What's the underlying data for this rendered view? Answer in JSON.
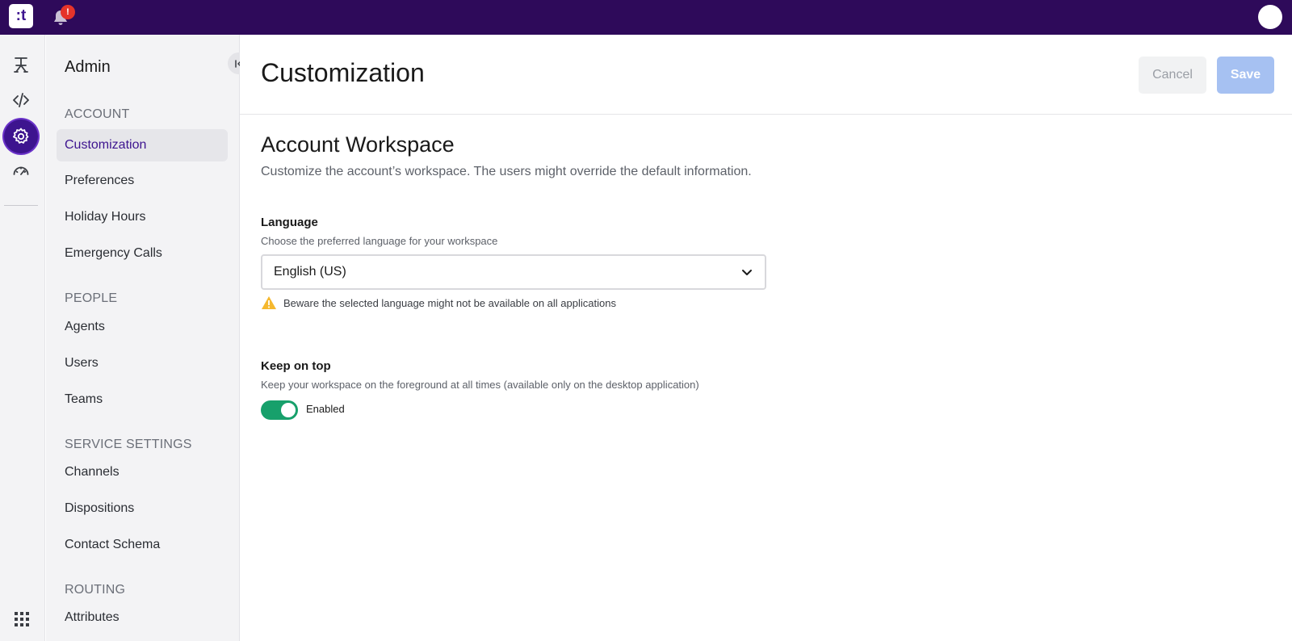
{
  "topbar": {
    "logo_text": ":t",
    "notification_count": "!",
    "icons": [
      "bell-icon",
      "avatar"
    ]
  },
  "rail": {
    "items": [
      "flow-icon",
      "code-icon",
      "gear-icon",
      "dashboard-icon"
    ],
    "active_item": "gear-icon",
    "bottom_icon": "apps-grid-icon"
  },
  "sidebar": {
    "title": "Admin",
    "sections": [
      {
        "heading": "ACCOUNT",
        "items": [
          "Customization",
          "Preferences",
          "Holiday Hours",
          "Emergency Calls"
        ]
      },
      {
        "heading": "PEOPLE",
        "items": [
          "Agents",
          "Users",
          "Teams"
        ]
      },
      {
        "heading": "SERVICE SETTINGS",
        "items": [
          "Channels",
          "Dispositions",
          "Contact Schema"
        ]
      },
      {
        "heading": "ROUTING",
        "items": [
          "Attributes"
        ]
      }
    ],
    "selected_item": "Customization"
  },
  "header": {
    "title": "Customization",
    "cancel_label": "Cancel",
    "save_label": "Save"
  },
  "workspace": {
    "title": "Account Workspace",
    "description": "Customize the account’s workspace. The users might override the default information."
  },
  "language": {
    "label": "Language",
    "help": "Choose the preferred language for your workspace",
    "selected": "English (US)",
    "warning": "Beware the selected language might not be available on all applications"
  },
  "keep_on_top": {
    "label": "Keep on top",
    "help": "Keep your workspace on the foreground at all times (available only on the desktop application)",
    "toggle_label": "Enabled",
    "enabled": true
  },
  "colors": {
    "topbar": "#2e0a5a",
    "accent": "#3d148f",
    "save_button": "#a6c1f2",
    "toggle_on": "#17a06b",
    "warning": "#f5b82e",
    "badge": "#e5342a"
  }
}
